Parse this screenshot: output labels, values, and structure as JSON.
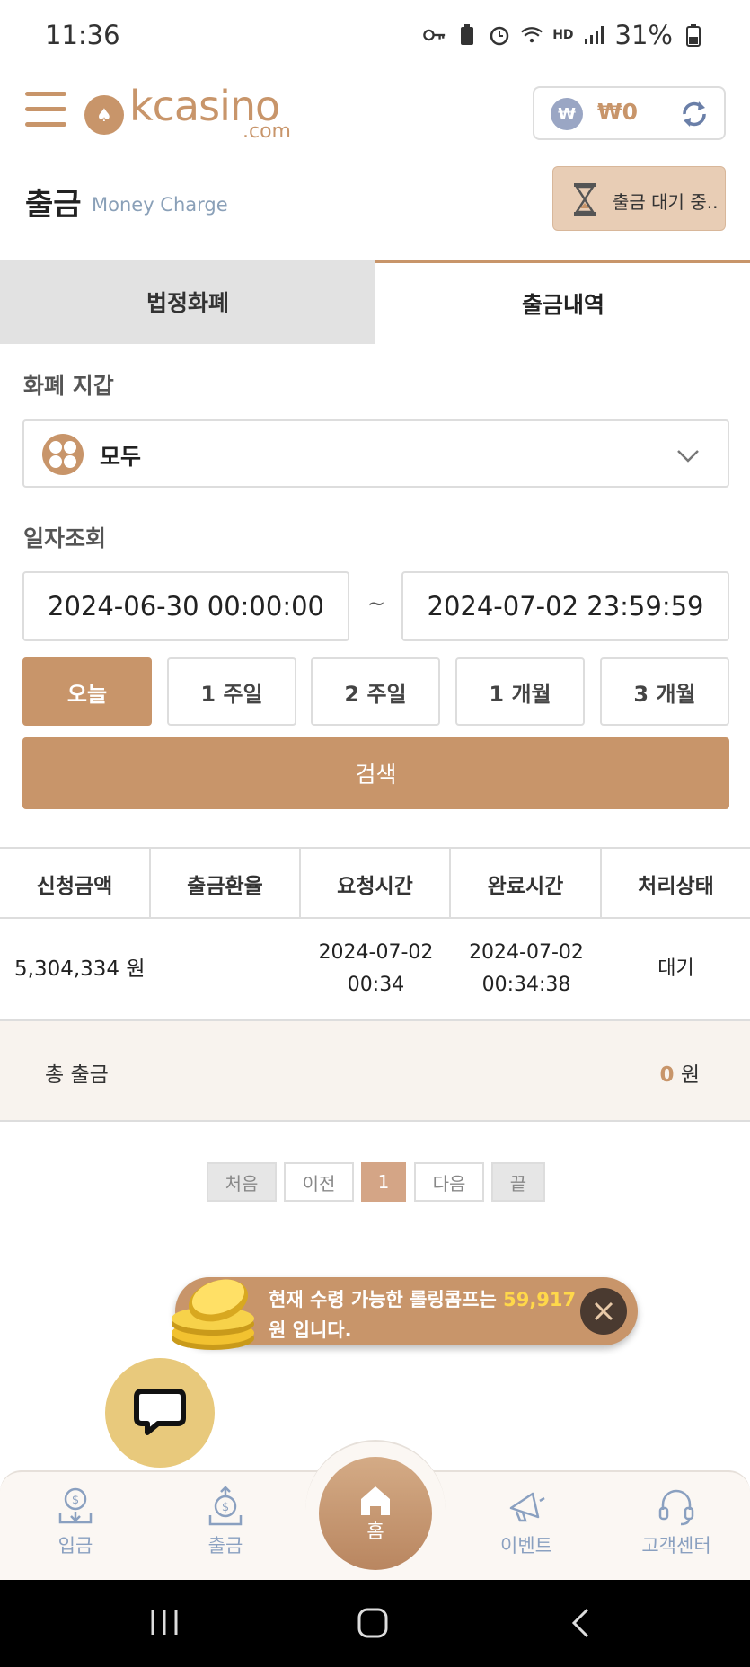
{
  "status_bar": {
    "time": "11:36",
    "network": "HD",
    "battery": "31%"
  },
  "header": {
    "logo_text": "kcasino",
    "logo_suffix": ".com",
    "wallet_currency_symbol": "₩",
    "wallet_amount": "₩0"
  },
  "page": {
    "title": "출금",
    "subtitle": "Money Charge",
    "pending_button": "출금 대기 중.."
  },
  "tabs": [
    {
      "label": "법정화폐",
      "active": false
    },
    {
      "label": "출금내역",
      "active": true
    }
  ],
  "wallet_section": {
    "label": "화폐 지갑",
    "selected": "모두"
  },
  "date_section": {
    "label": "일자조회",
    "start": "2024-06-30 00:00:00",
    "separator": "~",
    "end": "2024-07-02 23:59:59"
  },
  "ranges": [
    {
      "label": "오늘",
      "active": true
    },
    {
      "label": "1 주일",
      "active": false
    },
    {
      "label": "2 주일",
      "active": false
    },
    {
      "label": "1 개월",
      "active": false
    },
    {
      "label": "3 개월",
      "active": false
    }
  ],
  "search_button": "검색",
  "table": {
    "headers": [
      "신청금액",
      "출금환율",
      "요청시간",
      "완료시간",
      "처리상태"
    ],
    "rows": [
      {
        "amount": "5,304,334 원",
        "rate": "",
        "request_date": "2024-07-02",
        "request_time": "00:34",
        "complete_date": "2024-07-02",
        "complete_time": "00:34:38",
        "status": "대기"
      }
    ],
    "total_label": "총 출금",
    "total_value": "0",
    "total_unit": "원"
  },
  "pagination": {
    "first": "처음",
    "prev": "이전",
    "current": "1",
    "next": "다음",
    "last": "끝"
  },
  "rolling_banner": {
    "text_before": "현재 수령 가능한 롤링콤프는",
    "amount": "59,917",
    "text_after": "원 입니다."
  },
  "bottom_nav": {
    "deposit": "입금",
    "withdraw": "출금",
    "home": "홈",
    "event": "이벤트",
    "support": "고객센터"
  },
  "colors": {
    "accent": "#c8956a",
    "nav_text": "#8aa0c0",
    "highlight": "#ffd84a"
  }
}
